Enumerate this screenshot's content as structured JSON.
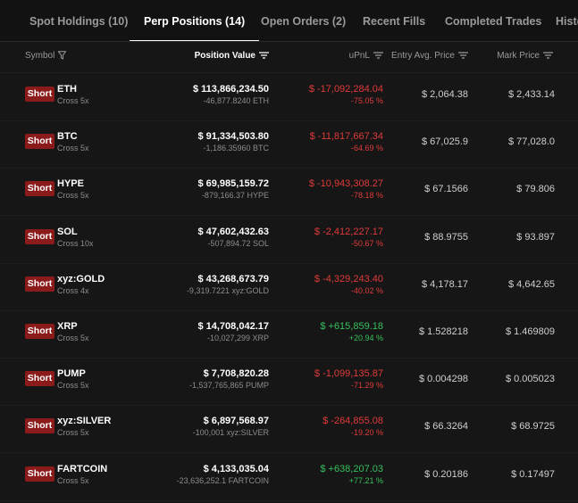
{
  "tabs": [
    {
      "label": "Spot Holdings (10)",
      "active": false
    },
    {
      "label": "Perp Positions (14)",
      "active": true
    },
    {
      "label": "Open Orders (2)",
      "active": false
    },
    {
      "label": "Recent Fills",
      "active": false
    },
    {
      "label": "Completed Trades",
      "active": false
    },
    {
      "label": "Histo",
      "active": false
    }
  ],
  "columns": {
    "symbol": "Symbol",
    "position_value": "Position Value",
    "upnl": "uPnL",
    "entry": "Entry Avg. Price",
    "mark": "Mark Price"
  },
  "colors": {
    "short_badge": "#8b1a1a",
    "negative": "#e03a3a",
    "positive": "#36c05c",
    "background": "#161616"
  },
  "rows": [
    {
      "side": "Short",
      "symbol": "ETH",
      "leverage": "Cross 5x",
      "value": "$ 113,866,234.50",
      "size": "-46,877.8240 ETH",
      "upnl": "$ -17,092,284.04",
      "upnl_pct": "-75.05 %",
      "positive": false,
      "entry": "$ 2,064.38",
      "mark": "$ 2,433.14"
    },
    {
      "side": "Short",
      "symbol": "BTC",
      "leverage": "Cross 5x",
      "value": "$ 91,334,503.80",
      "size": "-1,186.35960 BTC",
      "upnl": "$ -11,817,667.34",
      "upnl_pct": "-64.69 %",
      "positive": false,
      "entry": "$ 67,025.9",
      "mark": "$ 77,028.0"
    },
    {
      "side": "Short",
      "symbol": "HYPE",
      "leverage": "Cross 5x",
      "value": "$ 69,985,159.72",
      "size": "-879,166.37 HYPE",
      "upnl": "$ -10,943,308.27",
      "upnl_pct": "-78.18 %",
      "positive": false,
      "entry": "$ 67.1566",
      "mark": "$ 79.806"
    },
    {
      "side": "Short",
      "symbol": "SOL",
      "leverage": "Cross 10x",
      "value": "$ 47,602,432.63",
      "size": "-507,894.72 SOL",
      "upnl": "$ -2,412,227.17",
      "upnl_pct": "-50.67 %",
      "positive": false,
      "entry": "$ 88.9755",
      "mark": "$ 93.897"
    },
    {
      "side": "Short",
      "symbol": "xyz:GOLD",
      "leverage": "Cross 4x",
      "value": "$ 43,268,673.79",
      "size": "-9,319.7221 xyz:GOLD",
      "upnl": "$ -4,329,243.40",
      "upnl_pct": "-40.02 %",
      "positive": false,
      "entry": "$ 4,178.17",
      "mark": "$ 4,642.65"
    },
    {
      "side": "Short",
      "symbol": "XRP",
      "leverage": "Cross 5x",
      "value": "$ 14,708,042.17",
      "size": "-10,027,299 XRP",
      "upnl": "$ +615,859.18",
      "upnl_pct": "+20.94 %",
      "positive": true,
      "entry": "$ 1.528218",
      "mark": "$ 1.469809"
    },
    {
      "side": "Short",
      "symbol": "PUMP",
      "leverage": "Cross 5x",
      "value": "$ 7,708,820.28",
      "size": "-1,537,765,865 PUMP",
      "upnl": "$ -1,099,135.87",
      "upnl_pct": "-71.29 %",
      "positive": false,
      "entry": "$ 0.004298",
      "mark": "$ 0.005023"
    },
    {
      "side": "Short",
      "symbol": "xyz:SILVER",
      "leverage": "Cross 5x",
      "value": "$ 6,897,568.97",
      "size": "-100,001 xyz:SILVER",
      "upnl": "$ -264,855.08",
      "upnl_pct": "-19.20 %",
      "positive": false,
      "entry": "$ 66.3264",
      "mark": "$ 68.9725"
    },
    {
      "side": "Short",
      "symbol": "FARTCOIN",
      "leverage": "Cross 5x",
      "value": "$ 4,133,035.04",
      "size": "-23,636,252.1 FARTCOIN",
      "upnl": "$ +638,207.03",
      "upnl_pct": "+77.21 %",
      "positive": true,
      "entry": "$ 0.20186",
      "mark": "$ 0.17497"
    }
  ]
}
